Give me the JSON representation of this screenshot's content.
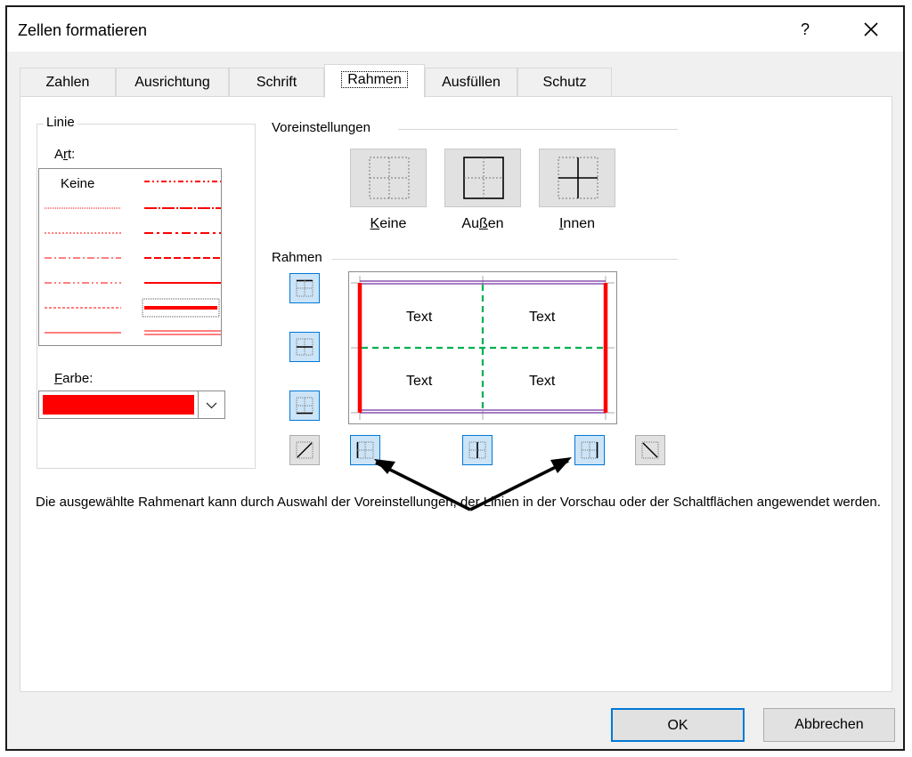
{
  "window": {
    "title": "Zellen formatieren",
    "help_label": "?"
  },
  "tabs": [
    {
      "label": "Zahlen"
    },
    {
      "label": "Ausrichtung"
    },
    {
      "label": "Schrift"
    },
    {
      "label": "Rahmen"
    },
    {
      "label": "Ausfüllen"
    },
    {
      "label": "Schutz"
    }
  ],
  "active_tab": "Rahmen",
  "line_group": {
    "title": "Linie",
    "style_label_pre": "A",
    "style_label_access": "r",
    "style_label_post": "t:",
    "none_option": "Keine",
    "color_label_access": "F",
    "color_label_post": "arbe:",
    "color_value": "#ff0000"
  },
  "presets": {
    "title": "Voreinstellungen",
    "items": [
      {
        "access": "K",
        "rest": "eine"
      },
      {
        "pre": "Au",
        "access": "ß",
        "rest": "en"
      },
      {
        "access": "I",
        "rest": "nnen"
      }
    ]
  },
  "border": {
    "title": "Rahmen",
    "preview_texts": [
      "Text",
      "Text",
      "Text",
      "Text"
    ],
    "accent_color": "#ff0000",
    "inner_color": "#00b050",
    "selection_color": "#7030a0"
  },
  "info_text": "Die ausgewählte Rahmenart kann durch Auswahl der Voreinstellungen, der Linien in der Vorschau oder der Schaltflächen angewendet werden.",
  "buttons": {
    "ok": "OK",
    "cancel": "Abbrechen"
  }
}
